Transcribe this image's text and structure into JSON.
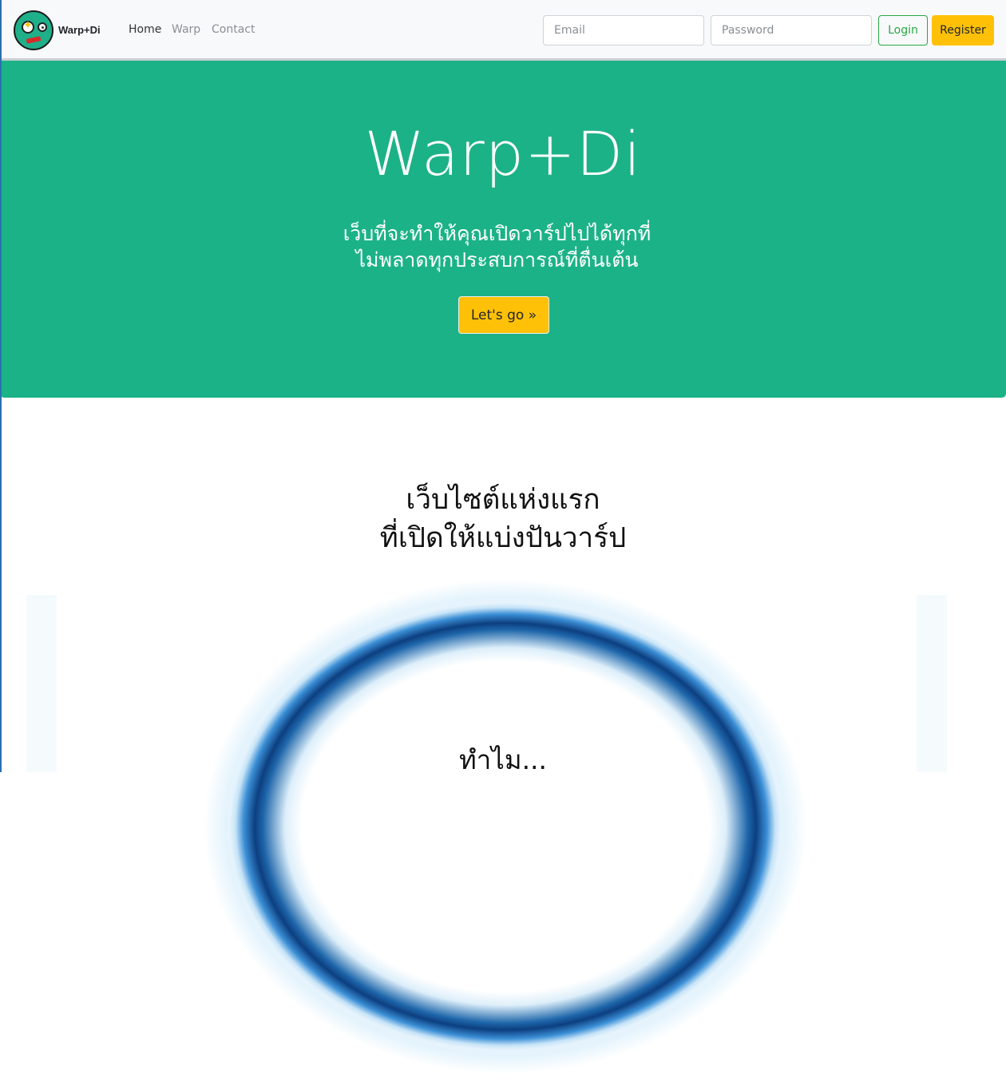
{
  "navbar": {
    "brand": "Warp+Di",
    "links": [
      "Home",
      "Warp",
      "Contact"
    ],
    "email_placeholder": "Email",
    "password_placeholder": "Password",
    "login_label": "Login",
    "register_label": "Register"
  },
  "hero": {
    "title": "Warp+Di",
    "subtitle_line1": "เว็บที่จะทำให้คุณเปิดวาร์ปไปได้ทุกที่",
    "subtitle_line2": "ไม่พลาดทุกประสบการณ์ที่ตื่นเต้น",
    "cta_label": "Let's go »"
  },
  "section": {
    "title_line1": "เว็บไซต์แห่งแรก",
    "title_line2": "ที่เปิดให้แบ่งปันวาร์ป",
    "why_label": "ทำไม..."
  },
  "colors": {
    "hero_bg": "#1cb287",
    "accent_yellow": "#ffc107",
    "login_green": "#28a745",
    "portal_blue": "#0c3f80"
  }
}
